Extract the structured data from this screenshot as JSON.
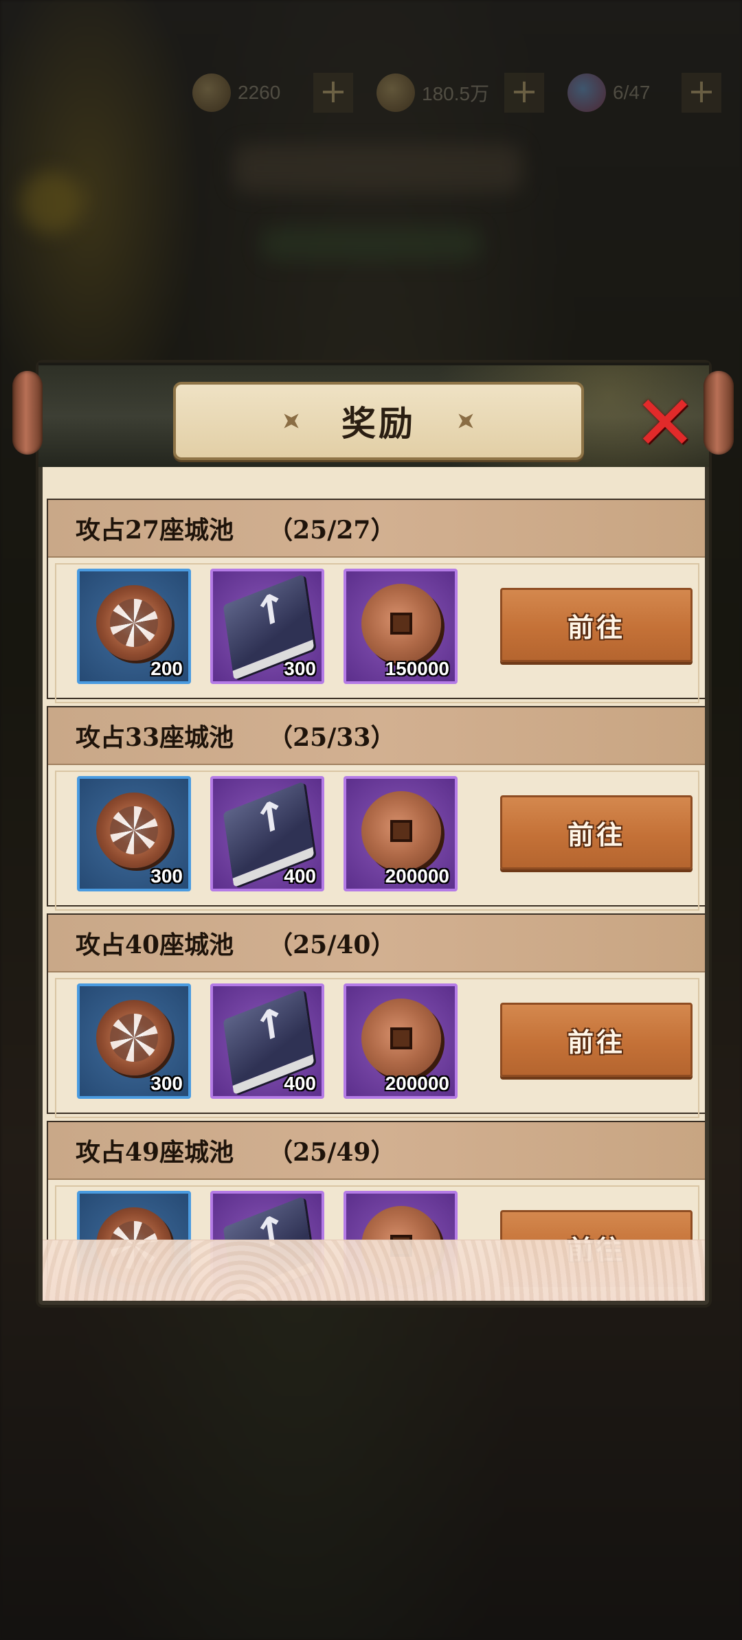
{
  "topbar": {
    "resources": [
      {
        "icon": "copper-coin-icon",
        "value": "2260"
      },
      {
        "icon": "copper-coin-icon",
        "value": "180.5万"
      },
      {
        "icon": "gem-icon",
        "value": "6/47"
      }
    ]
  },
  "dialog": {
    "title": "奖励",
    "close_icon": "close-x-icon"
  },
  "rewards": [
    {
      "title": "攻占27座城池",
      "progress": "（25/27）",
      "items": [
        {
          "icon": "swirl-coin-icon",
          "qty": "200",
          "frame": "blue"
        },
        {
          "icon": "skill-book-icon",
          "qty": "300",
          "frame": "purple"
        },
        {
          "icon": "copper-coin-icon",
          "qty": "150000",
          "frame": "purple"
        }
      ],
      "button": "前往"
    },
    {
      "title": "攻占33座城池",
      "progress": "（25/33）",
      "items": [
        {
          "icon": "swirl-coin-icon",
          "qty": "300",
          "frame": "blue"
        },
        {
          "icon": "skill-book-icon",
          "qty": "400",
          "frame": "purple"
        },
        {
          "icon": "copper-coin-icon",
          "qty": "200000",
          "frame": "purple"
        }
      ],
      "button": "前往"
    },
    {
      "title": "攻占40座城池",
      "progress": "（25/40）",
      "items": [
        {
          "icon": "swirl-coin-icon",
          "qty": "300",
          "frame": "blue"
        },
        {
          "icon": "skill-book-icon",
          "qty": "400",
          "frame": "purple"
        },
        {
          "icon": "copper-coin-icon",
          "qty": "200000",
          "frame": "purple"
        }
      ],
      "button": "前往"
    },
    {
      "title": "攻占49座城池",
      "progress": "（25/49）",
      "items": [
        {
          "icon": "swirl-coin-icon",
          "qty": "",
          "frame": "blue"
        },
        {
          "icon": "skill-book-icon",
          "qty": "",
          "frame": "purple"
        },
        {
          "icon": "copper-coin-icon",
          "qty": "",
          "frame": "purple"
        }
      ],
      "button": "前往"
    }
  ]
}
